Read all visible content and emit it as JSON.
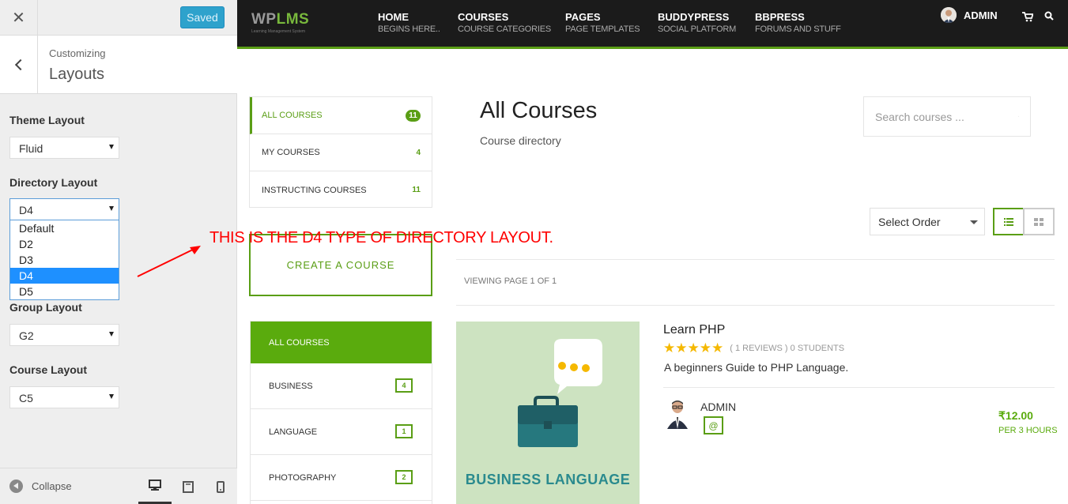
{
  "customizer": {
    "close_label": "✕",
    "saved_label": "Saved",
    "customizing_label": "Customizing",
    "section_title": "Layouts",
    "theme_layout": {
      "label": "Theme Layout",
      "value": "Fluid"
    },
    "directory_layout": {
      "label": "Directory Layout",
      "value": "D4",
      "options": [
        "Default",
        "D2",
        "D3",
        "D4",
        "D5"
      ]
    },
    "group_layout": {
      "label": "Group Layout",
      "value": "G2"
    },
    "course_layout": {
      "label": "Course Layout",
      "value": "C5"
    },
    "collapse_label": "Collapse"
  },
  "site": {
    "logo_wp": "WP",
    "logo_lms": "LMS",
    "logo_tagline": "Learning Management System",
    "nav": [
      {
        "label": "Home",
        "sub": "Begins here.."
      },
      {
        "label": "Courses",
        "sub": "Course Categories"
      },
      {
        "label": "Pages",
        "sub": "Page Templates"
      },
      {
        "label": "BuddyPress",
        "sub": "Social Platform"
      },
      {
        "label": "BBPress",
        "sub": "Forums and stuff"
      }
    ],
    "user_name": "ADMIN"
  },
  "content": {
    "tabs": [
      {
        "label": "All Courses",
        "count": "11"
      },
      {
        "label": "My Courses",
        "count": "4"
      },
      {
        "label": "Instructing Courses",
        "count": "11"
      }
    ],
    "create_course_label": "Create a Course",
    "categories_head": "All Courses",
    "categories": [
      {
        "name": "Business",
        "count": "4"
      },
      {
        "name": "Language",
        "count": "1"
      },
      {
        "name": "Photography",
        "count": "2"
      }
    ],
    "page_title": "All Courses",
    "page_subtitle": "Course directory",
    "search_placeholder": "Search courses ...",
    "order_label": "Select Order",
    "viewing_page": "Viewing page 1 of 1",
    "course": {
      "thumb_text": "BUSINESS LANGUAGE",
      "title": "Learn PHP",
      "rating_stars": 5,
      "reviews": "( 1 REVIEWS )",
      "students": "0 STUDENTS",
      "description": "A beginners Guide to PHP Language.",
      "instructor": "ADMIN",
      "instructor_mail_icon": "@",
      "price": "₹12.00",
      "duration": "PER 3 HOURS"
    }
  },
  "annotation": {
    "text": "THIS IS THE D4 TYPE OF DIRECTORY LAYOUT.",
    "color": "#ff0000"
  },
  "colors": {
    "accent_green": "#5a9e15",
    "customizer_saved_blue": "#2ea2cc",
    "nav_bg": "#1b1b1b"
  }
}
